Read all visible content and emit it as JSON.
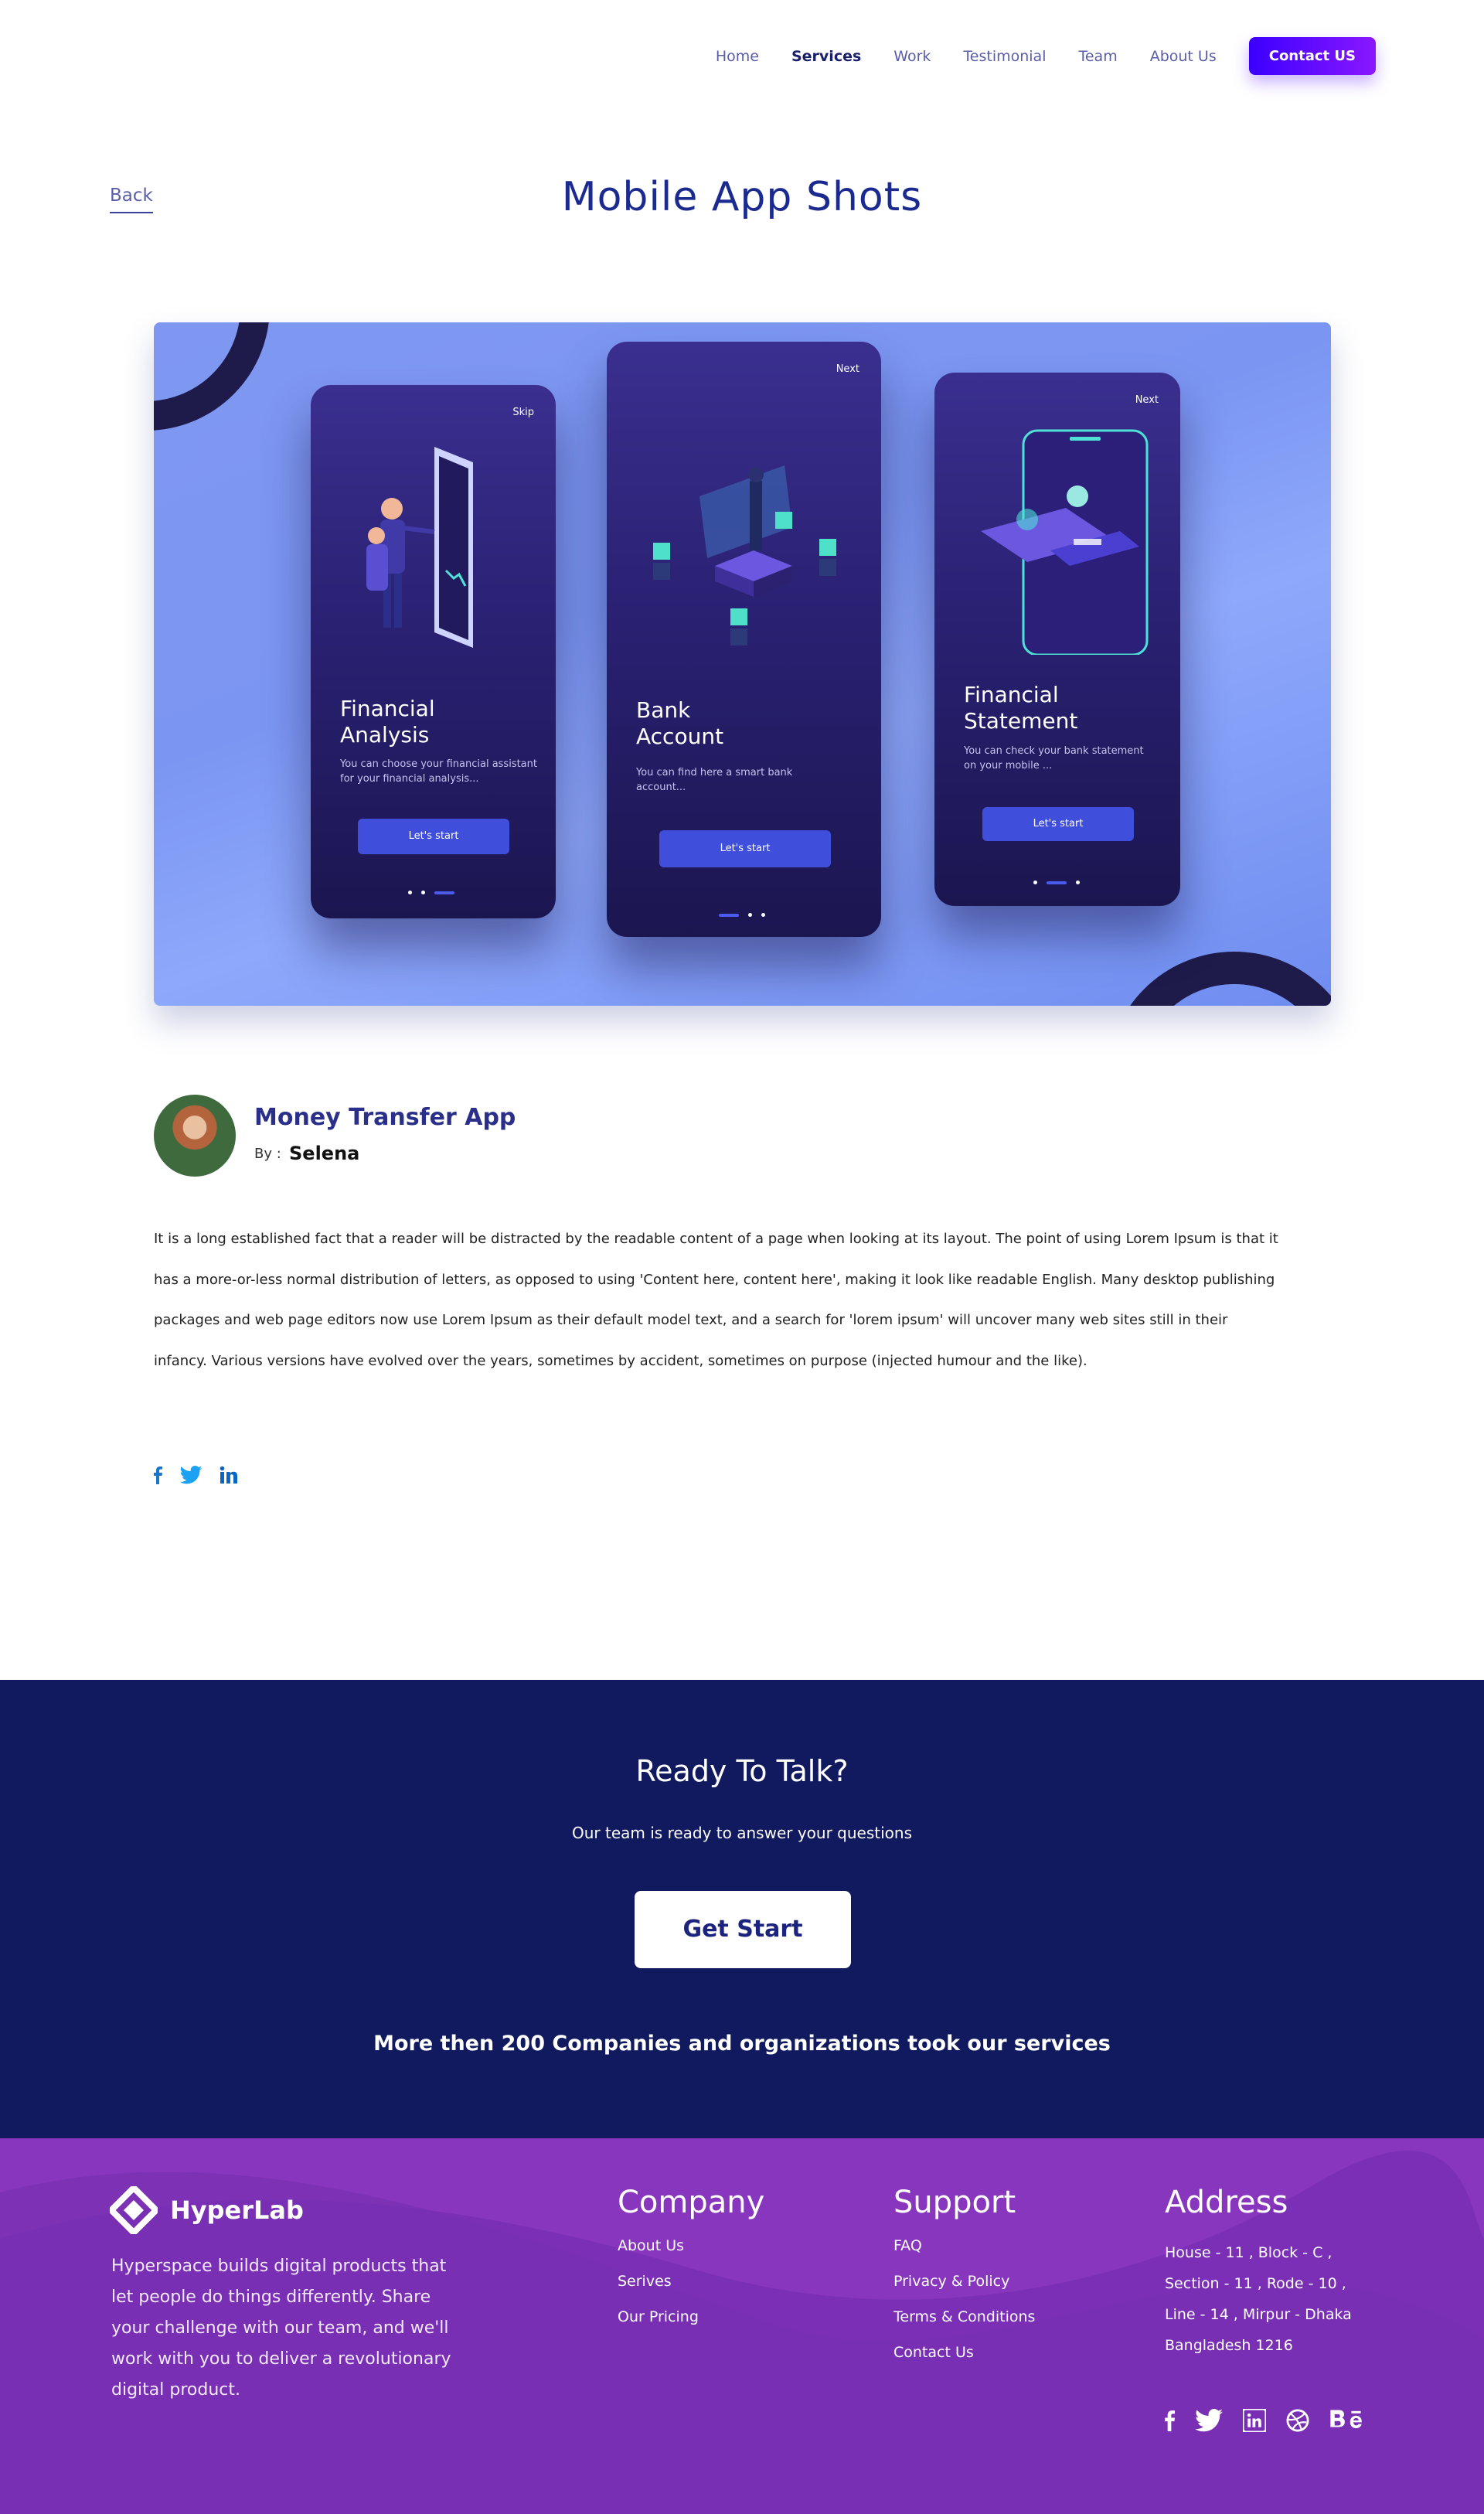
{
  "nav": {
    "items": [
      "Home",
      "Services",
      "Work",
      "Testimonial",
      "Team",
      "About Us"
    ],
    "active": "Services",
    "contact_label": "Contact US"
  },
  "back_label": "Back",
  "page_title": "Mobile App Shots",
  "hero": {
    "phones": [
      {
        "top_label": "Skip",
        "title_line1": "Financial",
        "title_line2": "Analysis",
        "text_line1": "You can choose your financial assistant",
        "text_line2": "for your financial analysis...",
        "button": "Let's start"
      },
      {
        "top_label": "Next",
        "title_line1": "Bank",
        "title_line2": "Account",
        "text_line1": "You can find here a smart bank",
        "text_line2": "account...",
        "button": "Let's start"
      },
      {
        "top_label": "Next",
        "title_line1": "Financial",
        "title_line2": "Statement",
        "text_line1": "You can check your bank statement",
        "text_line2": "on your mobile ...",
        "button": "Let's start"
      }
    ]
  },
  "project": {
    "name": "Money Transfer App",
    "by_label": "By :",
    "author": "Selena",
    "description": "It is a long established fact that a reader will be distracted by the readable content of a page when looking at its layout. The point of using Lorem Ipsum is that it has a more-or-less normal distribution of letters, as opposed to using 'Content here, content here', making it look like readable English. Many desktop publishing packages and web page editors now use Lorem Ipsum as their default model text, and a search for 'lorem ipsum' will uncover many web sites still in their infancy. Various versions have evolved over the years, sometimes by accident, sometimes on purpose (injected humour and the like)."
  },
  "share_icons": [
    "facebook-icon",
    "twitter-icon",
    "linkedin-icon"
  ],
  "cta": {
    "title": "Ready To Talk?",
    "subtitle": "Our team is ready to answer your questions",
    "button": "Get Start",
    "companies": "More then 200 Companies and organizations took our services"
  },
  "footer": {
    "brand": "HyperLab",
    "about": "Hyperspace builds digital products that let people do things differently. Share your challenge with our team, and we'll work with you to deliver a revolutionary digital product.",
    "company": {
      "title": "Company",
      "links": [
        "About Us",
        "Serives",
        "Our Pricing"
      ]
    },
    "support": {
      "title": "Support",
      "links": [
        "FAQ",
        "Privacy & Policy",
        "Terms & Conditions",
        "Contact Us"
      ]
    },
    "address": {
      "title": "Address",
      "text": "House - 11 , Block - C , Section - 11 , Rode - 10 , Line - 14 , Mirpur - Dhaka Bangladesh 1216"
    },
    "social_icons": [
      "facebook-icon",
      "twitter-icon",
      "linkedin-icon",
      "dribbble-icon",
      "behance-icon"
    ]
  },
  "colors": {
    "primary_dark": "#111a5e",
    "title_blue": "#1b2a8f",
    "footer_purple": "#7b2fb6",
    "contact_gradient_start": "#3b00ff",
    "contact_gradient_end": "#8a17ff"
  }
}
